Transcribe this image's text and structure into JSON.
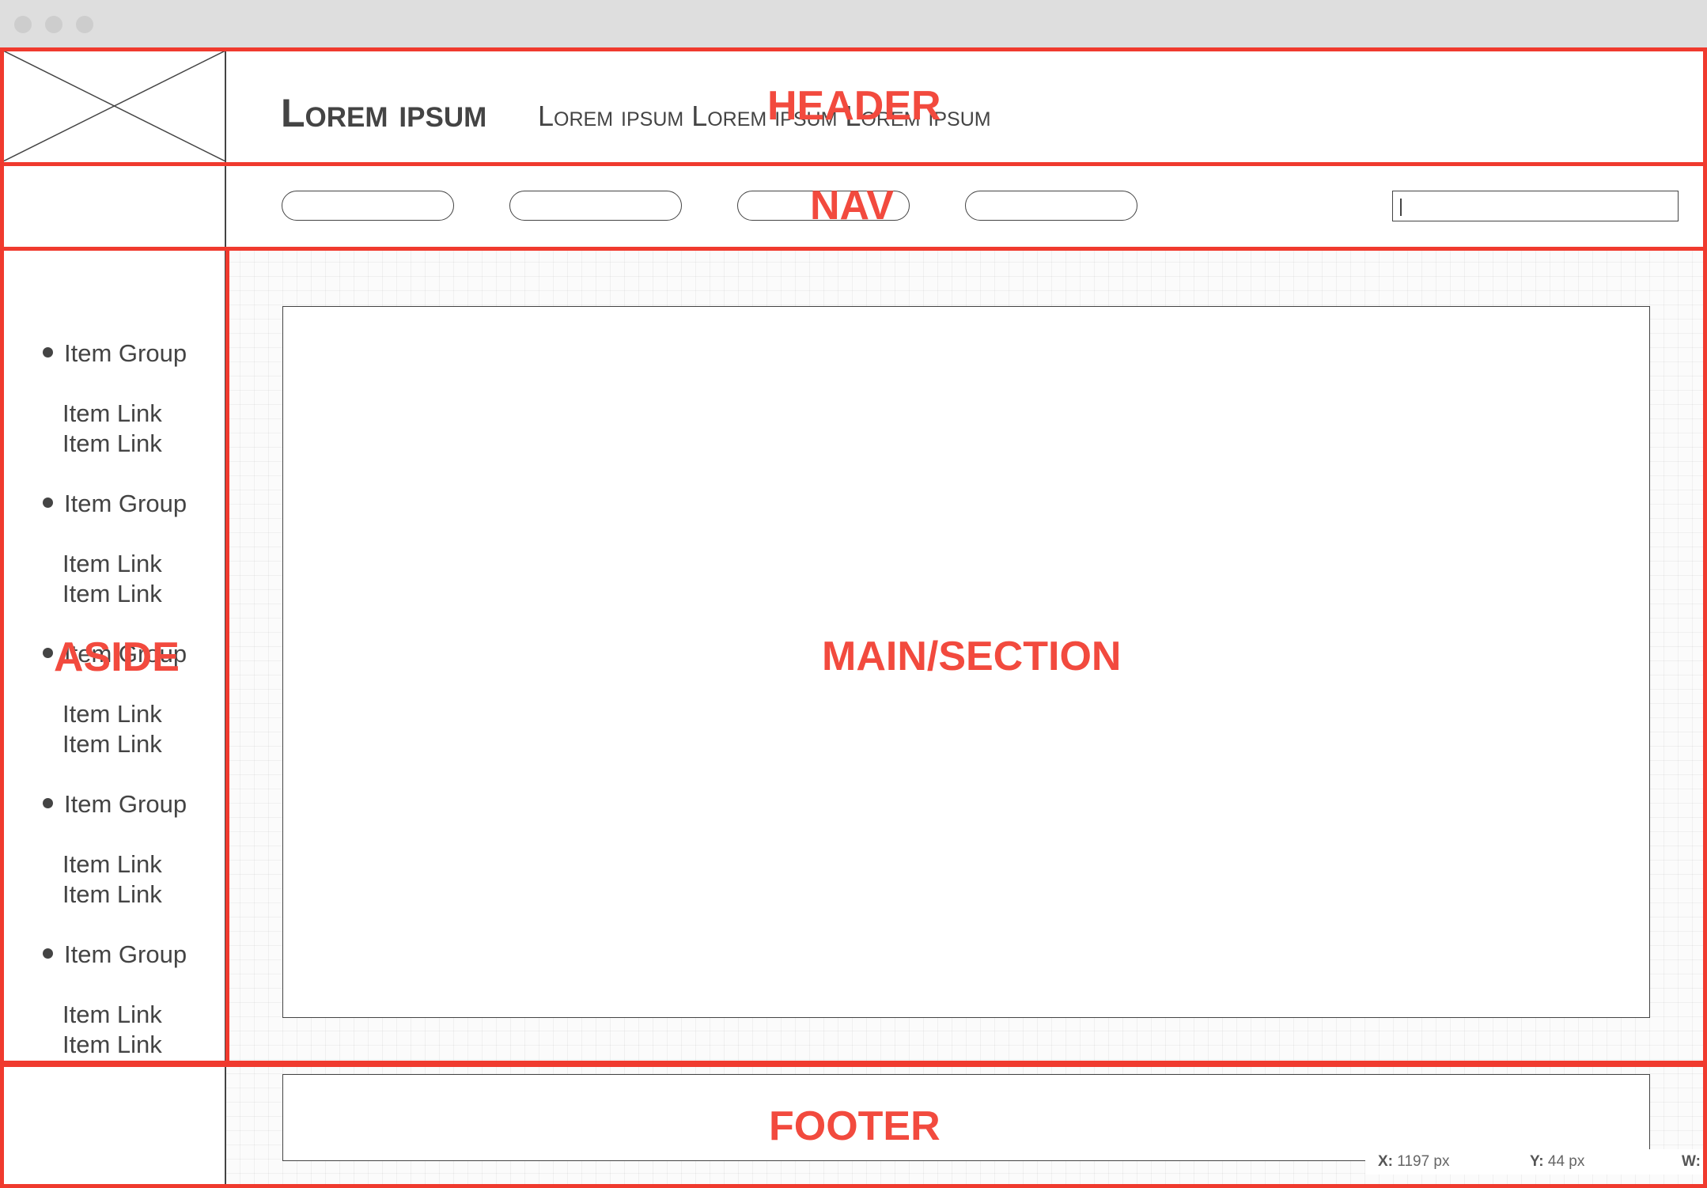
{
  "header": {
    "title": "Lorem ipsum",
    "tagline": "Lorem ipsum Lorem ipsum Lorem ipsum"
  },
  "nav": {
    "buttons": [
      "",
      "",
      "",
      ""
    ],
    "search": {
      "value": "",
      "placeholder": ""
    }
  },
  "aside": {
    "groups": [
      {
        "label": "Item Group",
        "links": [
          "Item Link",
          "Item Link"
        ]
      },
      {
        "label": "Item Group",
        "links": [
          "Item Link",
          "Item Link"
        ]
      },
      {
        "label": "Item Group",
        "links": [
          "Item Link",
          "Item Link"
        ]
      },
      {
        "label": "Item Group",
        "links": [
          "Item Link",
          "Item Link"
        ]
      },
      {
        "label": "Item Group",
        "links": [
          "Item Link",
          "Item Link"
        ]
      }
    ]
  },
  "regions": {
    "header": "HEADER",
    "nav": "NAV",
    "aside": "ASIDE",
    "main": "MAIN/SECTION",
    "footer": "FOOTER"
  },
  "status": {
    "x_label": "X:",
    "x_value": "1197 px",
    "y_label": "Y:",
    "y_value": "44 px",
    "w_label": "W:"
  },
  "colors": {
    "region_outline": "#f03a2e",
    "wireframe_stroke": "#444444",
    "titlebar": "#dedede"
  }
}
